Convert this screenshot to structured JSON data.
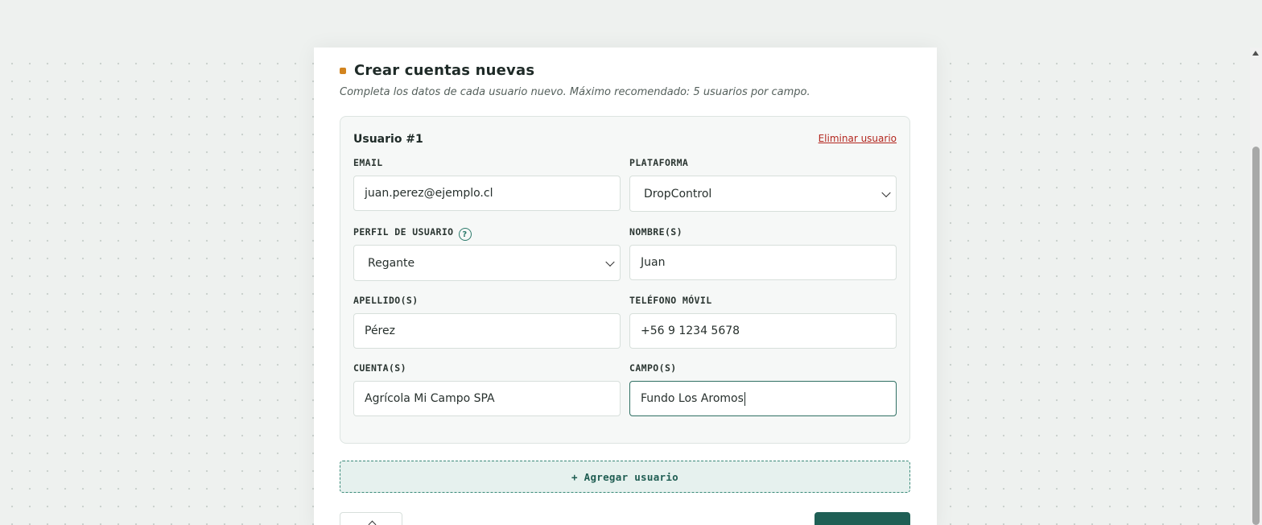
{
  "section": {
    "title": "Crear cuentas nuevas",
    "subtitle": "Completa los datos de cada usuario nuevo. Máximo recomendado: 5 usuarios por campo."
  },
  "user": {
    "heading": "Usuario #1",
    "delete_label": "Eliminar usuario",
    "fields": {
      "email": {
        "label": "EMAIL",
        "value": "juan.perez@ejemplo.cl"
      },
      "plataforma": {
        "label": "PLATAFORMA",
        "value": "DropControl"
      },
      "perfil": {
        "label": "PERFIL DE USUARIO",
        "value": "Regante",
        "help_icon": "?"
      },
      "nombre": {
        "label": "NOMBRE(S)",
        "value": "Juan"
      },
      "apellido": {
        "label": "APELLIDO(S)",
        "value": "Pérez"
      },
      "telefono": {
        "label": "TELÉFONO MÓVIL",
        "value": "+56 9 1234 5678"
      },
      "cuenta": {
        "label": "CUENTA(S)",
        "value": "Agrícola Mi Campo SPA"
      },
      "campo": {
        "label": "CAMPO(S)",
        "value": "Fundo Los Aromos"
      }
    }
  },
  "add_user_label": "+ Agregar usuario",
  "icons": {
    "back": "arrow-up-icon",
    "help": "help-circle-icon"
  },
  "colors": {
    "accent": "#1f5f55",
    "bullet": "#d2841f",
    "danger": "#b3261e"
  }
}
